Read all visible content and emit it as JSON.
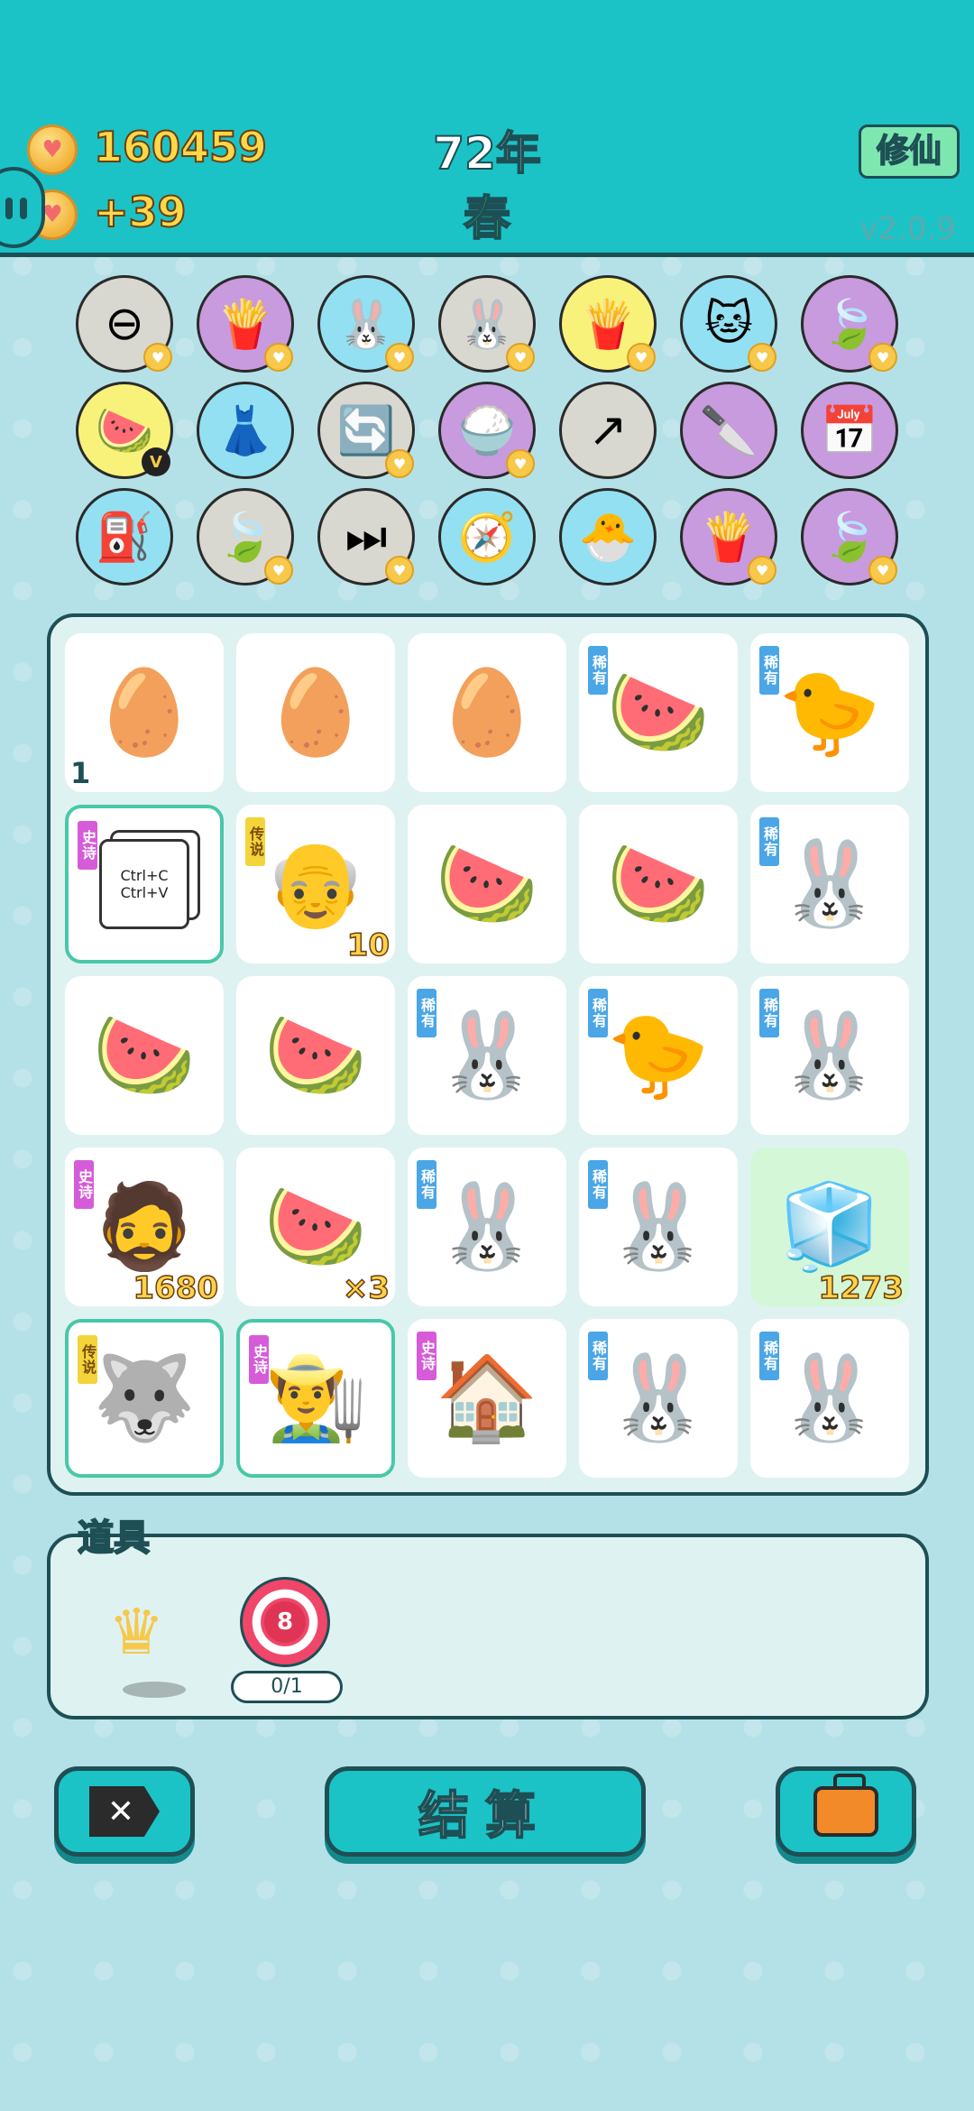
{
  "header": {
    "coins": "160459",
    "income": "+39",
    "year": "72年",
    "season": "春",
    "xiuxian_label": "修仙",
    "version": "v2.0.9"
  },
  "relics": [
    {
      "icon": "⊖",
      "color": "grey",
      "name": "minus-sign-icon",
      "heart": true
    },
    {
      "icon": "🍟",
      "color": "purple",
      "name": "fries-icon",
      "heart": true
    },
    {
      "icon": "🐰",
      "color": "blue",
      "name": "rabbit-icon",
      "heart": true
    },
    {
      "icon": "🐰",
      "color": "grey",
      "name": "rabbit-icon",
      "heart": true
    },
    {
      "icon": "🍟",
      "color": "yellow",
      "name": "fries-icon",
      "heart": true
    },
    {
      "icon": "🐱",
      "color": "blue",
      "name": "cat-icon",
      "heart": true
    },
    {
      "icon": "🍃",
      "color": "purple",
      "name": "leaf-icon",
      "heart": true
    },
    {
      "icon": "🍉",
      "color": "yellow",
      "name": "fruit-basket-icon",
      "badge": "V"
    },
    {
      "icon": "👗",
      "color": "blue",
      "name": "skirt-icon"
    },
    {
      "icon": "🔄",
      "color": "grey",
      "name": "refresh-icon",
      "heart": true
    },
    {
      "icon": "🍚",
      "color": "purple",
      "name": "rice-bowl-icon",
      "heart": true
    },
    {
      "icon": "↗",
      "color": "grey",
      "name": "arrow-up-right-icon"
    },
    {
      "icon": "🔪",
      "color": "purple",
      "name": "cleaver-icon"
    },
    {
      "icon": "📅",
      "color": "purple",
      "name": "calendar-icon"
    },
    {
      "icon": "⛽",
      "color": "blue",
      "name": "pump-icon"
    },
    {
      "icon": "🍃",
      "color": "grey",
      "name": "leaf-icon",
      "heart": true
    },
    {
      "icon": "⏭",
      "color": "grey",
      "name": "skip-icon",
      "heart": true
    },
    {
      "icon": "🧭",
      "color": "blue",
      "name": "compass-icon"
    },
    {
      "icon": "🐣",
      "color": "blue",
      "name": "chick-egg-icon"
    },
    {
      "icon": "🍟",
      "color": "purple",
      "name": "fries-icon",
      "heart": true
    },
    {
      "icon": "🍃",
      "color": "purple",
      "name": "leaf-icon",
      "heart": true
    }
  ],
  "board": [
    {
      "icon": "🥚",
      "name": "egg-icon",
      "num_left": "1"
    },
    {
      "icon": "🥚",
      "name": "egg-icon"
    },
    {
      "icon": "🥚",
      "name": "egg-icon"
    },
    {
      "icon": "🍉",
      "name": "watermelon-slice-icon",
      "tag": "稀有",
      "tag_type": "rare"
    },
    {
      "icon": "🐤",
      "name": "chicken-icon",
      "tag": "稀有",
      "tag_type": "rare"
    },
    {
      "icon": "ctrl",
      "name": "ctrl-c-v-card-icon",
      "tag": "史诗",
      "tag_type": "epic",
      "border": true,
      "ctrl_c": "Ctrl+C",
      "ctrl_v": "Ctrl+V"
    },
    {
      "icon": "👴",
      "name": "old-man-glasses-icon",
      "tag": "传说",
      "tag_type": "legend",
      "num": "10"
    },
    {
      "icon": "🍉",
      "name": "watermelon-icon"
    },
    {
      "icon": "🍉",
      "name": "watermelon-icon"
    },
    {
      "icon": "🐰",
      "name": "rabbit-icon",
      "tag": "稀有",
      "tag_type": "rare"
    },
    {
      "icon": "🍉",
      "name": "watermelon-icon"
    },
    {
      "icon": "🍉",
      "name": "watermelon-icon"
    },
    {
      "icon": "🐰",
      "name": "rabbit-icon",
      "tag": "稀有",
      "tag_type": "rare"
    },
    {
      "icon": "🐤",
      "name": "chicken-icon",
      "tag": "稀有",
      "tag_type": "rare"
    },
    {
      "icon": "🐰",
      "name": "rabbit-icon",
      "tag": "稀有",
      "tag_type": "rare"
    },
    {
      "icon": "🧔",
      "name": "bearded-man-icon",
      "tag": "史诗",
      "tag_type": "epic",
      "num": "1680"
    },
    {
      "icon": "🍉",
      "name": "watermelon-icon",
      "num": "×3"
    },
    {
      "icon": "🐰",
      "name": "rabbit-icon",
      "tag": "稀有",
      "tag_type": "rare"
    },
    {
      "icon": "🐰",
      "name": "rabbit-icon",
      "tag": "稀有",
      "tag_type": "rare"
    },
    {
      "icon": "🧊",
      "name": "fridge-icon",
      "num": "1273",
      "green": true
    },
    {
      "icon": "🐺",
      "name": "husky-crown-icon",
      "tag": "传说",
      "tag_type": "legend",
      "border": true
    },
    {
      "icon": "👨‍🌾",
      "name": "farmer-man-icon",
      "tag": "史诗",
      "tag_type": "epic",
      "border": true
    },
    {
      "icon": "🏠",
      "name": "rabbit-house-icon",
      "tag": "史诗",
      "tag_type": "epic"
    },
    {
      "icon": "🐰",
      "name": "rabbit-icon",
      "tag": "稀有",
      "tag_type": "rare"
    },
    {
      "icon": "🐰",
      "name": "rabbit-icon",
      "tag": "稀有",
      "tag_type": "rare"
    }
  ],
  "items": {
    "title": "道具",
    "target_number": "8",
    "target_count": "0/1"
  },
  "buttons": {
    "close_label": "✕",
    "settle_label": "结算"
  }
}
